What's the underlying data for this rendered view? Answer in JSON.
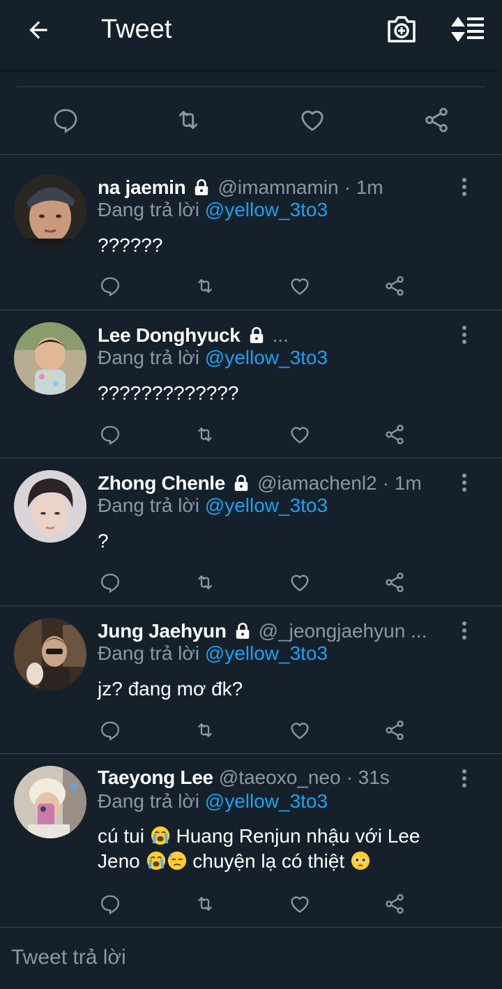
{
  "header": {
    "title": "Tweet",
    "back_icon": "arrow-left-icon",
    "camera_icon": "camera-plus-icon",
    "sort_icon": "sort-icon"
  },
  "reply_prefix": "Đang trả lời",
  "tweets": [
    {
      "name": "na jaemin",
      "protected": true,
      "handle": "@imamnamin",
      "time": "· 1m",
      "mention": "@yellow_3to3",
      "text": "??????"
    },
    {
      "name": "Lee Donghyuck",
      "protected": true,
      "handle": "...",
      "time": "",
      "mention": "@yellow_3to3",
      "text": "?????????????"
    },
    {
      "name": "Zhong Chenle",
      "protected": true,
      "handle": "@iamachenl2",
      "time": "· 1m",
      "mention": "@yellow_3to3",
      "text": "?"
    },
    {
      "name": "Jung Jaehyun",
      "protected": true,
      "handle": "@_jeongjaehyun ...",
      "time": "",
      "mention": "@yellow_3to3",
      "text": "jz? đang mơ đk?"
    },
    {
      "name": "Taeyong Lee",
      "protected": false,
      "handle": "@taeoxo_neo",
      "time": "· 31s",
      "mention": "@yellow_3to3",
      "text_part1": "cú tui",
      "text_part2": "Huang Renjun nhậu với Lee",
      "text_part3": "Jeno",
      "text_part4": "chuyện lạ có thiệt"
    }
  ],
  "composer": {
    "placeholder": "Tweet trả lời"
  },
  "colors": {
    "background": "#15202b",
    "divider": "#38444d",
    "secondary_text": "#8899a6",
    "accent": "#1da1f2"
  }
}
